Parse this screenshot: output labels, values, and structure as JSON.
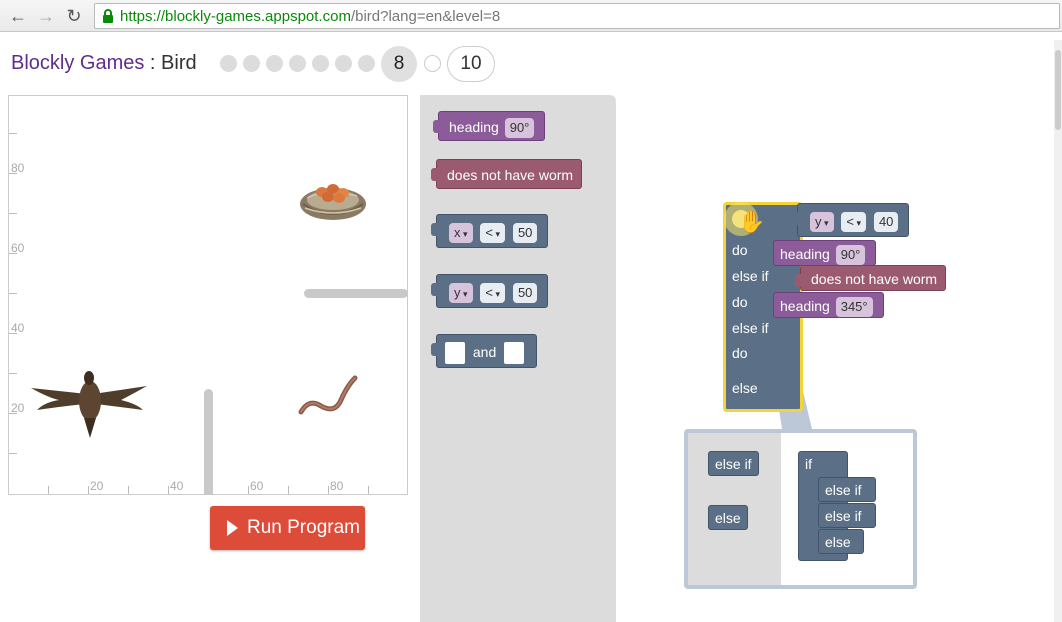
{
  "browser": {
    "url_host": "https://blockly-games.appspot.com",
    "url_path": "/bird?lang=en&level=8"
  },
  "header": {
    "app_name": "Blockly Games",
    "separator": " : ",
    "game_name": "Bird",
    "current_level": "8",
    "last_level": "10"
  },
  "canvas": {
    "y_labels": [
      "80",
      "60",
      "40",
      "20"
    ],
    "x_labels": [
      "20",
      "40",
      "60",
      "80"
    ]
  },
  "run_button": {
    "label": "Run Program"
  },
  "toolbox": {
    "heading_label": "heading",
    "heading_value": "90°",
    "no_worm_label": "does not have worm",
    "x_var": "x",
    "y_var": "y",
    "op_lt": "<",
    "num_50": "50",
    "and_label": "and"
  },
  "workspace": {
    "cond_var": "y",
    "cond_op": "<",
    "cond_value": "40",
    "do_label": "do",
    "else_if_label": "else if",
    "else_label": "else",
    "heading1_label": "heading",
    "heading1_value": "90°",
    "worm_label": "does not have worm",
    "heading2_label": "heading",
    "heading2_value": "345°"
  },
  "mutator": {
    "palette_else_if": "else if",
    "palette_else": "else",
    "if_label": "if",
    "else_if_1": "else if",
    "else_if_2": "else if",
    "else_label": "else"
  }
}
